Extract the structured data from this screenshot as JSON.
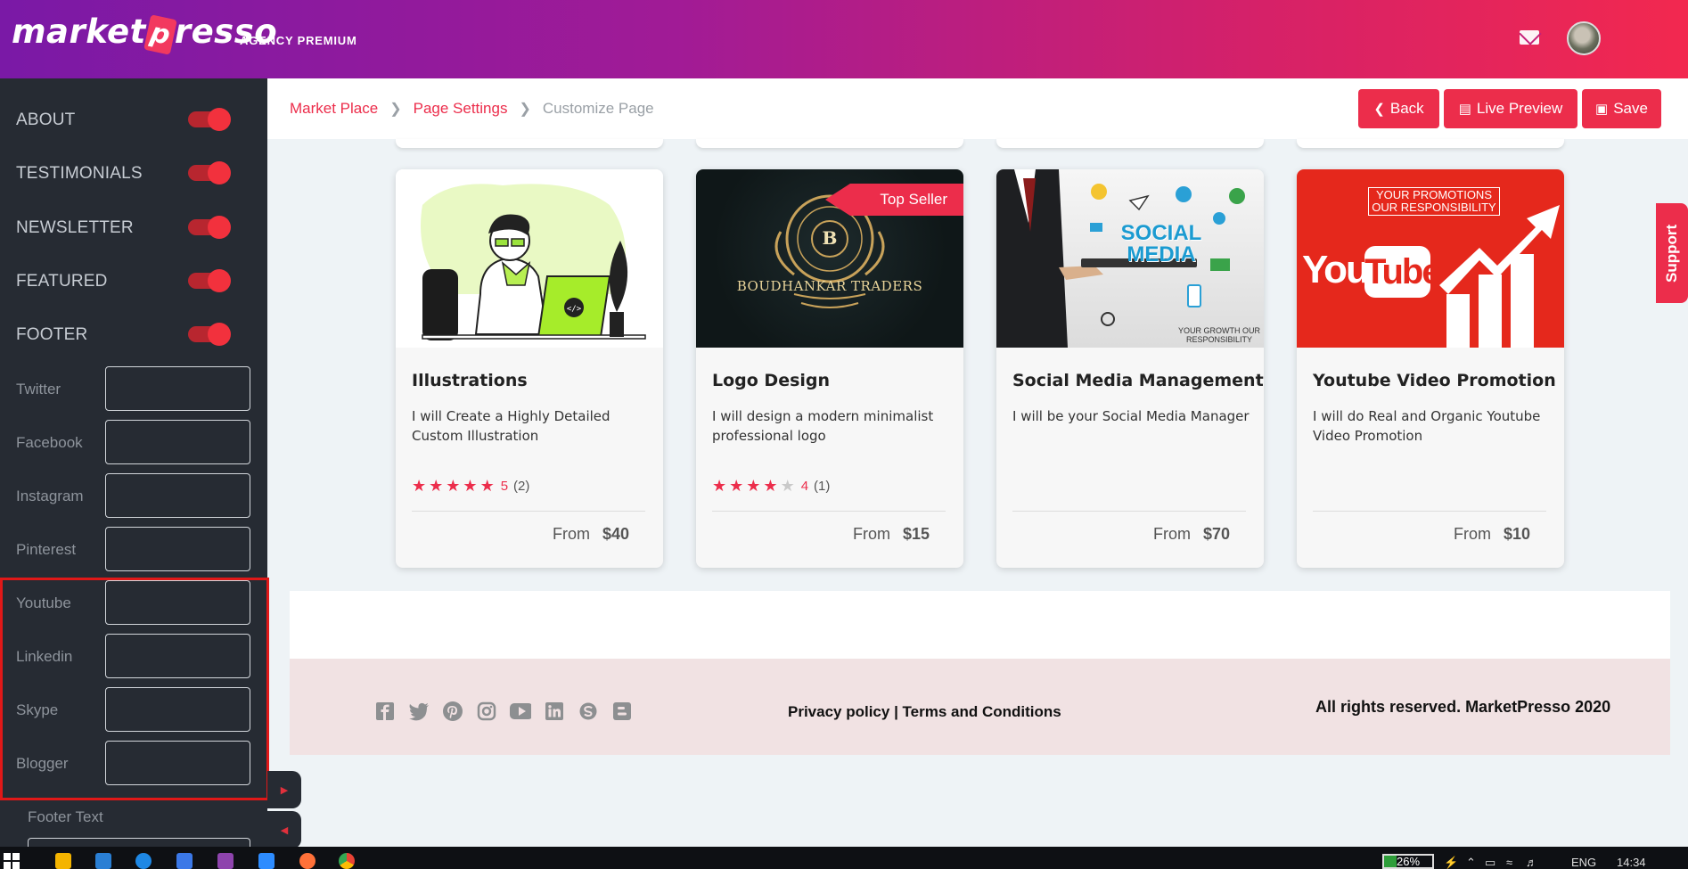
{
  "header": {
    "logo_left": "market",
    "logo_bag": "p",
    "logo_right": "resso",
    "logo_sub": "AGENCY PREMIUM"
  },
  "sidebar": {
    "toggles": [
      {
        "label": "ABOUT",
        "on": true
      },
      {
        "label": "TESTIMONIALS",
        "on": true
      },
      {
        "label": "NEWSLETTER",
        "on": true
      },
      {
        "label": "FEATURED",
        "on": true
      },
      {
        "label": "FOOTER",
        "on": true
      }
    ],
    "fields": [
      {
        "label": "Twitter",
        "value": ""
      },
      {
        "label": "Facebook",
        "value": ""
      },
      {
        "label": "Instagram",
        "value": ""
      },
      {
        "label": "Pinterest",
        "value": ""
      },
      {
        "label": "Youtube",
        "value": ""
      },
      {
        "label": "Linkedin",
        "value": ""
      },
      {
        "label": "Skype",
        "value": ""
      },
      {
        "label": "Blogger",
        "value": ""
      }
    ],
    "footer_text_label": "Footer Text"
  },
  "breadcrumb": {
    "items": [
      "Market Place",
      "Page Settings",
      "Customize Page"
    ]
  },
  "actions": {
    "back": "Back",
    "live_preview": "Live Preview",
    "save": "Save"
  },
  "cards": [
    {
      "title": "Illustrations",
      "desc": "I will Create a Highly Detailed Custom Illustration",
      "rating": "5",
      "count": "(2)",
      "stars": 5,
      "from": "From",
      "price": "$40"
    },
    {
      "title": "Logo Design",
      "desc": "I will design a modern minimalist professional logo",
      "rating": "4",
      "count": "(1)",
      "stars": 4,
      "from": "From",
      "price": "$15",
      "badge": "Top Seller",
      "image_text": "BOUDHANKAR TRADERS",
      "image_letter": "B"
    },
    {
      "title": "Social Media Management",
      "desc": "I will be your Social Media Manager",
      "from": "From",
      "price": "$70",
      "image_text": "SOCIAL MEDIA",
      "image_sub": "YOUR GROWTH OUR RESPONSIBILITY"
    },
    {
      "title": "Youtube Video Promotion",
      "desc": "I will do Real and Organic Youtube Video Promotion",
      "from": "From",
      "price": "$10",
      "image_text": "YOUR PROMOTIONS OUR RESPONSIBILITY",
      "image_brand": "You",
      "image_brand2": "Tube"
    }
  ],
  "support": "Support",
  "footer": {
    "social_icons": [
      "facebook-icon",
      "twitter-icon",
      "pinterest-icon",
      "instagram-icon",
      "youtube-icon",
      "linkedin-icon",
      "skype-icon",
      "blogger-icon"
    ],
    "privacy": "Privacy policy",
    "sep": " | ",
    "terms": "Terms and Conditions",
    "copyright": "All rights reserved. MarketPresso 2020"
  },
  "taskbar": {
    "battery": "26%",
    "lang": "ENG",
    "time": "14:34"
  },
  "colors": {
    "accent": "#ec2d4b",
    "sidebar": "#262b33",
    "footer_bg": "#f1e2e3"
  }
}
